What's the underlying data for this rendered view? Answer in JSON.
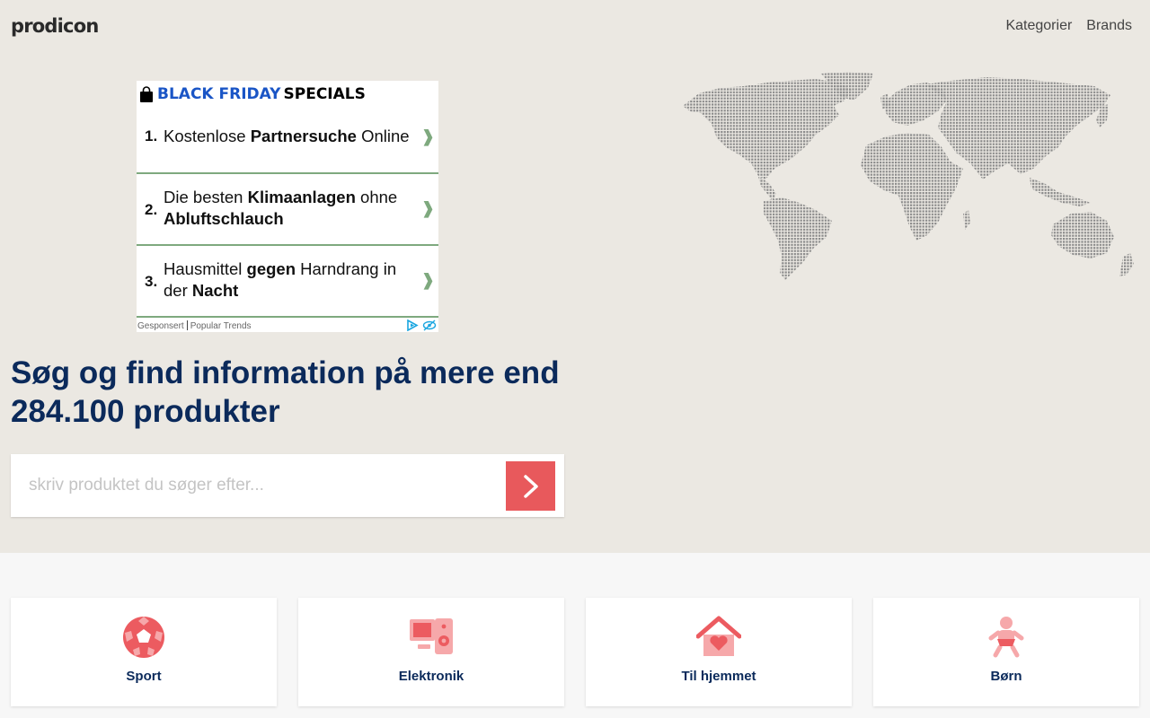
{
  "header": {
    "logo": "prodicon",
    "nav": [
      "Kategorier",
      "Brands"
    ]
  },
  "ad": {
    "title_blue": "BLACK FRIDAY",
    "title_black": "SPECIALS",
    "items": [
      {
        "num": "1.",
        "pre": "Kostenlose ",
        "bold": "Partnersuche",
        "post": " Online"
      },
      {
        "num": "2.",
        "pre": "Die besten ",
        "bold": "Klimaanlagen",
        "post": " ohne ",
        "bold2": "Abluftschlauch",
        "post2": ""
      },
      {
        "num": "3.",
        "pre": "Hausmittel ",
        "bold": "gegen",
        "post": " Harndrang in der ",
        "bold2": "Nacht",
        "post2": ""
      }
    ],
    "footer_sponsored": "Gesponsert",
    "footer_source": "Popular Trends",
    "chevron": "❱"
  },
  "hero": {
    "headline": "Søg og find information på mere end 284.100 produkter",
    "search_placeholder": "skriv produktet du søger efter..."
  },
  "categories": [
    {
      "label": "Sport",
      "icon": "soccer-ball-icon"
    },
    {
      "label": "Elektronik",
      "icon": "electronics-icon"
    },
    {
      "label": "Til hjemmet",
      "icon": "home-heart-icon"
    },
    {
      "label": "Børn",
      "icon": "baby-icon"
    }
  ],
  "colors": {
    "hero_bg": "#ebe8e2",
    "accent": "#e8595c",
    "heading": "#0b2a5b",
    "ad_green": "#7ea97e"
  }
}
